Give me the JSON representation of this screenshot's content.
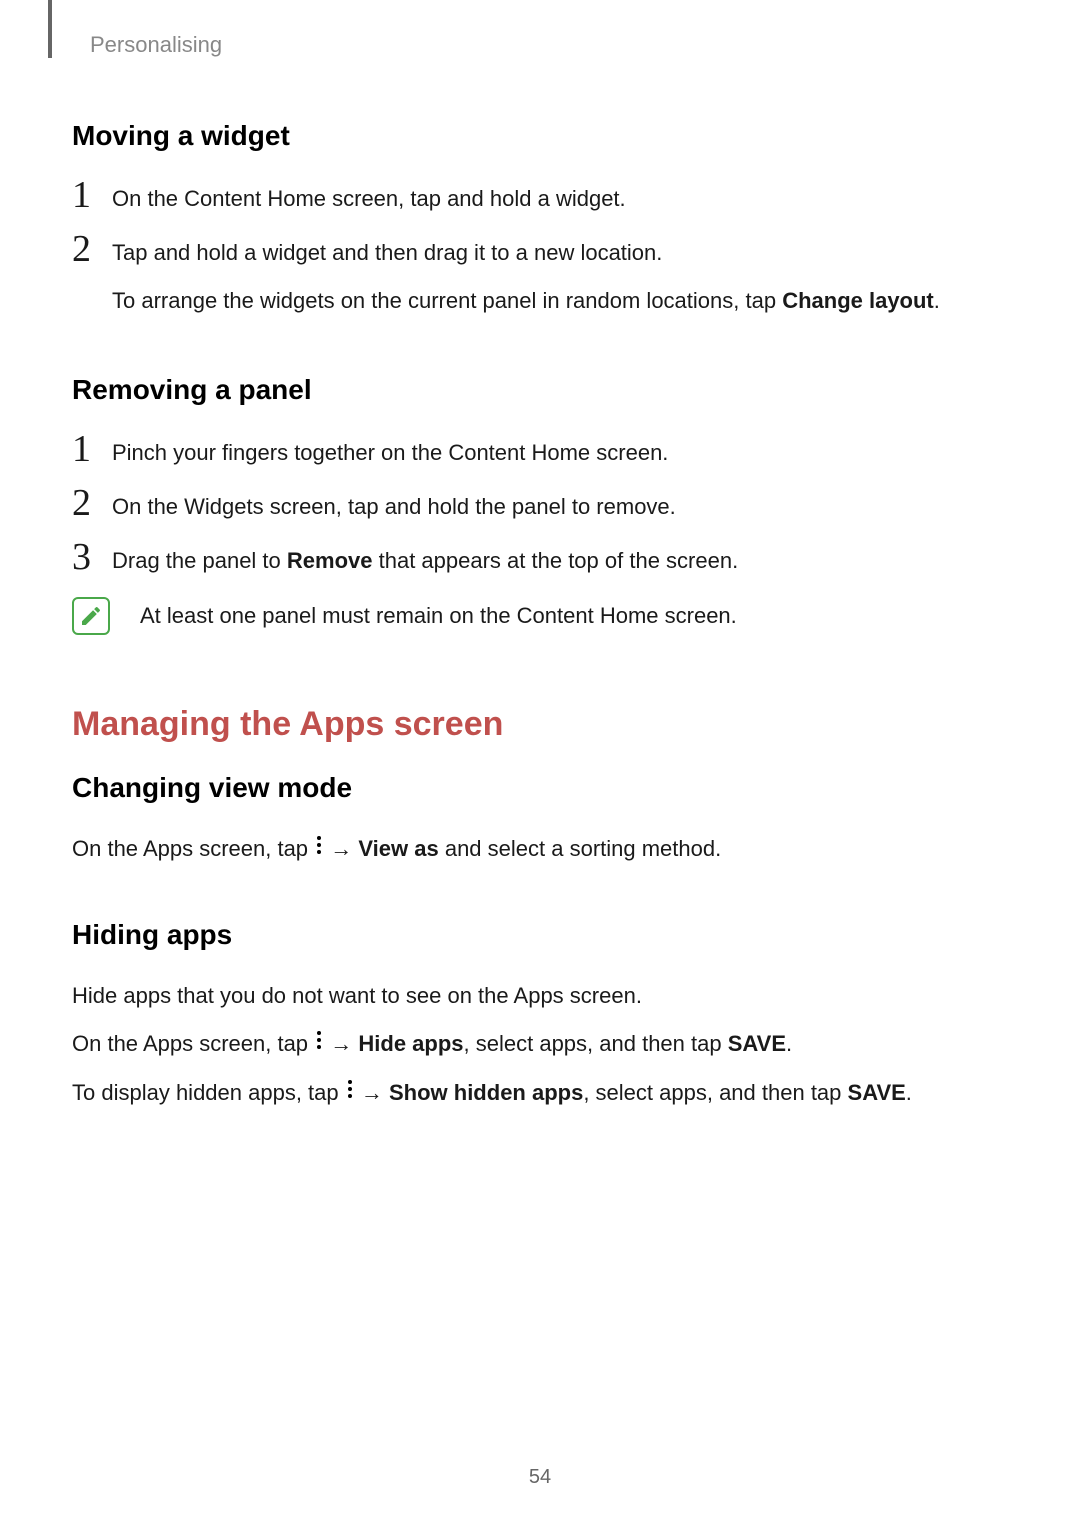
{
  "header": {
    "section": "Personalising"
  },
  "sections": {
    "moving_widget": {
      "title": "Moving a widget",
      "steps": [
        {
          "num": "1",
          "text": "On the Content Home screen, tap and hold a widget."
        },
        {
          "num": "2",
          "text_pre": "Tap and hold a widget and then drag it to a new location.",
          "text_sub_pre": "To arrange the widgets on the current panel in random locations, tap ",
          "text_sub_bold": "Change layout",
          "text_sub_post": "."
        }
      ]
    },
    "removing_panel": {
      "title": "Removing a panel",
      "steps": [
        {
          "num": "1",
          "text": "Pinch your fingers together on the Content Home screen."
        },
        {
          "num": "2",
          "text": "On the Widgets screen, tap and hold the panel to remove."
        },
        {
          "num": "3",
          "text_pre": "Drag the panel to ",
          "text_bold": "Remove",
          "text_post": " that appears at the top of the screen."
        }
      ],
      "note": "At least one panel must remain on the Content Home screen."
    },
    "managing_apps": {
      "heading": "Managing the Apps screen"
    },
    "changing_view_mode": {
      "title": "Changing view mode",
      "line": {
        "pre": "On the Apps screen, tap ",
        "arrow": " → ",
        "bold": "View as",
        "post": " and select a sorting method."
      }
    },
    "hiding_apps": {
      "title": "Hiding apps",
      "line1": "Hide apps that you do not want to see on the Apps screen.",
      "line2": {
        "pre": "On the Apps screen, tap ",
        "arrow": " → ",
        "bold": "Hide apps",
        "mid": ", select apps, and then tap ",
        "bold2": "SAVE",
        "post": "."
      },
      "line3": {
        "pre": "To display hidden apps, tap ",
        "arrow": " → ",
        "bold": "Show hidden apps",
        "mid": ", select apps, and then tap ",
        "bold2": "SAVE",
        "post": "."
      }
    }
  },
  "page_number": "54"
}
